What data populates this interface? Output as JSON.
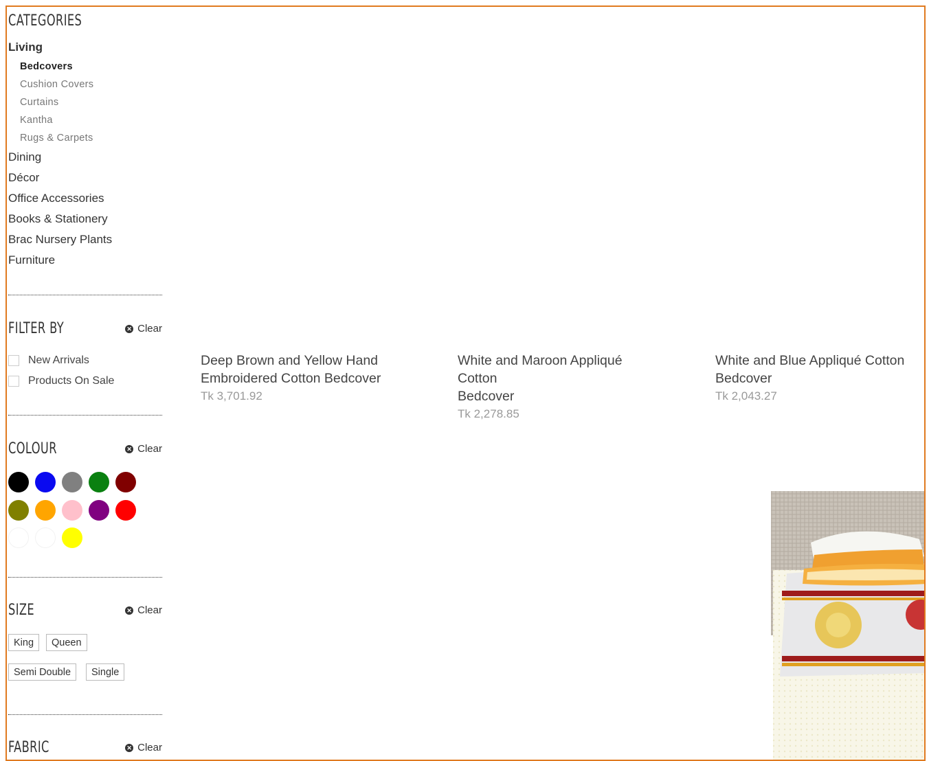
{
  "sidebar": {
    "categories_title": "CATEGORIES",
    "categories": [
      {
        "label": "Living",
        "bold": true,
        "subs": [
          {
            "label": "Bedcovers",
            "active": true
          },
          {
            "label": "Cushion Covers",
            "active": false
          },
          {
            "label": "Curtains",
            "active": false
          },
          {
            "label": "Kantha",
            "active": false
          },
          {
            "label": "Rugs & Carpets",
            "active": false
          }
        ]
      },
      {
        "label": "Dining"
      },
      {
        "label": "Décor"
      },
      {
        "label": "Office Accessories"
      },
      {
        "label": "Books & Stationery"
      },
      {
        "label": "Brac Nursery Plants"
      },
      {
        "label": "Furniture"
      }
    ],
    "filter_by": {
      "title": "FILTER BY",
      "clear": "Clear",
      "options": [
        "New Arrivals",
        "Products On Sale"
      ]
    },
    "colour": {
      "title": "COLOUR",
      "clear": "Clear",
      "swatches": [
        "#000000",
        "#0a0af0",
        "#808080",
        "#0a8010",
        "#800000",
        "#808000",
        "#ffa500",
        "#ffc0cb",
        "#800080",
        "#ff0000",
        "#ffffff",
        "#ffffff",
        "#ffff00"
      ]
    },
    "size": {
      "title": "SIZE",
      "clear": "Clear",
      "options": [
        "King",
        "Queen",
        "Semi Double",
        "Single"
      ]
    },
    "fabric": {
      "title": "FABRIC",
      "clear": "Clear"
    }
  },
  "products": [
    {
      "name_line1": "Deep Brown and Yellow Hand",
      "name_line2": "Embroidered Cotton Bedcover",
      "price": "Tk 3,701.92"
    },
    {
      "name_line1": "White and Maroon Appliqué Cotton",
      "name_line2": "Bedcover",
      "price": "Tk 2,278.85"
    },
    {
      "name_line1": "White and Blue Appliqué Cotton",
      "name_line2": "Bedcover",
      "price": "Tk 2,043.27"
    }
  ],
  "colors": {
    "border": "#e07a1f"
  }
}
